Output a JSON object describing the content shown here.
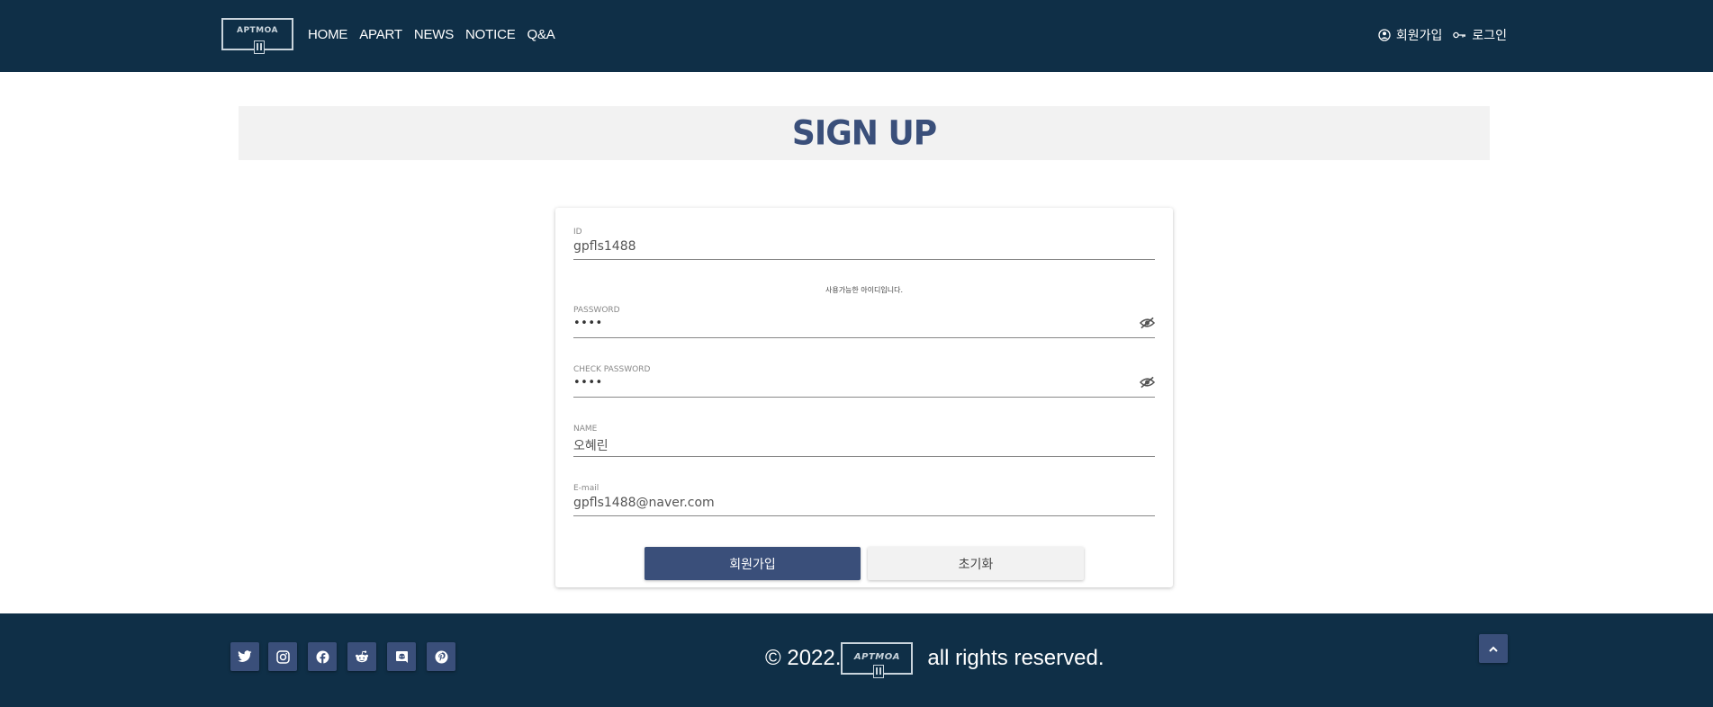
{
  "header": {
    "logo_text": "APTMOA",
    "nav": [
      "HOME",
      "APART",
      "NEWS",
      "NOTICE",
      "Q&A"
    ],
    "signup_label": "회원가입",
    "login_label": "로그인"
  },
  "banner": {
    "title": "SIGN UP"
  },
  "form": {
    "id": {
      "label": "ID",
      "value": "gpfls1488"
    },
    "id_hint": "사용가능한 아이디입니다.",
    "password": {
      "label": "PASSWORD",
      "value": "••••"
    },
    "check_password": {
      "label": "CHECK PASSWORD",
      "value": "••••"
    },
    "name": {
      "label": "NAME",
      "value": "오혜린"
    },
    "email": {
      "label": "E-mail",
      "value": "gpfls1488@naver.com"
    },
    "submit_label": "회원가입",
    "reset_label": "초기화"
  },
  "footer": {
    "social_icons": [
      "twitter-icon",
      "instagram-icon",
      "facebook-icon",
      "reddit-icon",
      "discord-icon",
      "pinterest-icon"
    ],
    "copyright_prefix": "© 2022.",
    "logo_text": "APTMOA",
    "copyright_suffix": "all rights reserved."
  },
  "colors": {
    "header_bg": "#0f2f47",
    "accent": "#3a4f7a",
    "banner_bg": "#f2f2f2"
  }
}
